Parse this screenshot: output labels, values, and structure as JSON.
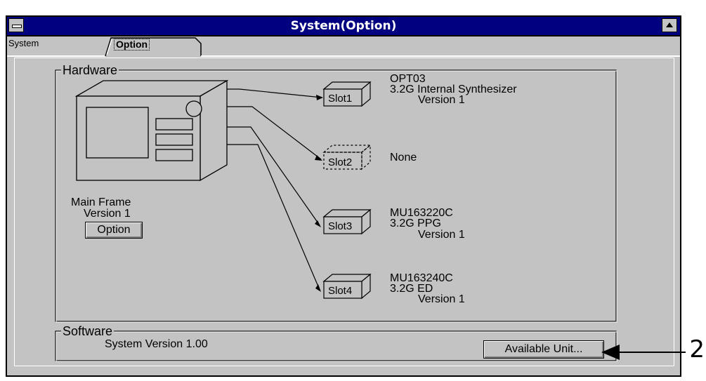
{
  "window": {
    "title": "System(Option)"
  },
  "tabs": [
    {
      "label": "System",
      "selected": false
    },
    {
      "label": "Option",
      "selected": true
    }
  ],
  "hardware": {
    "group_label": "Hardware",
    "main_frame": {
      "name": "Main Frame",
      "version": "Version 1",
      "button_label": "Option"
    },
    "slots": [
      {
        "label": "Slot1",
        "unit": "OPT03",
        "desc": "3.2G Internal Synthesizer",
        "version": "Version 1",
        "installed": true
      },
      {
        "label": "Slot2",
        "unit": "None",
        "desc": "",
        "version": "",
        "installed": false
      },
      {
        "label": "Slot3",
        "unit": "MU163220C",
        "desc": "3.2G PPG",
        "version": "Version 1",
        "installed": true
      },
      {
        "label": "Slot4",
        "unit": "MU163240C",
        "desc": "3.2G ED",
        "version": "Version 1",
        "installed": true
      }
    ]
  },
  "software": {
    "group_label": "Software",
    "system_version": "System Version  1.00",
    "button_label": "Available Unit..."
  },
  "callout_number": "2"
}
